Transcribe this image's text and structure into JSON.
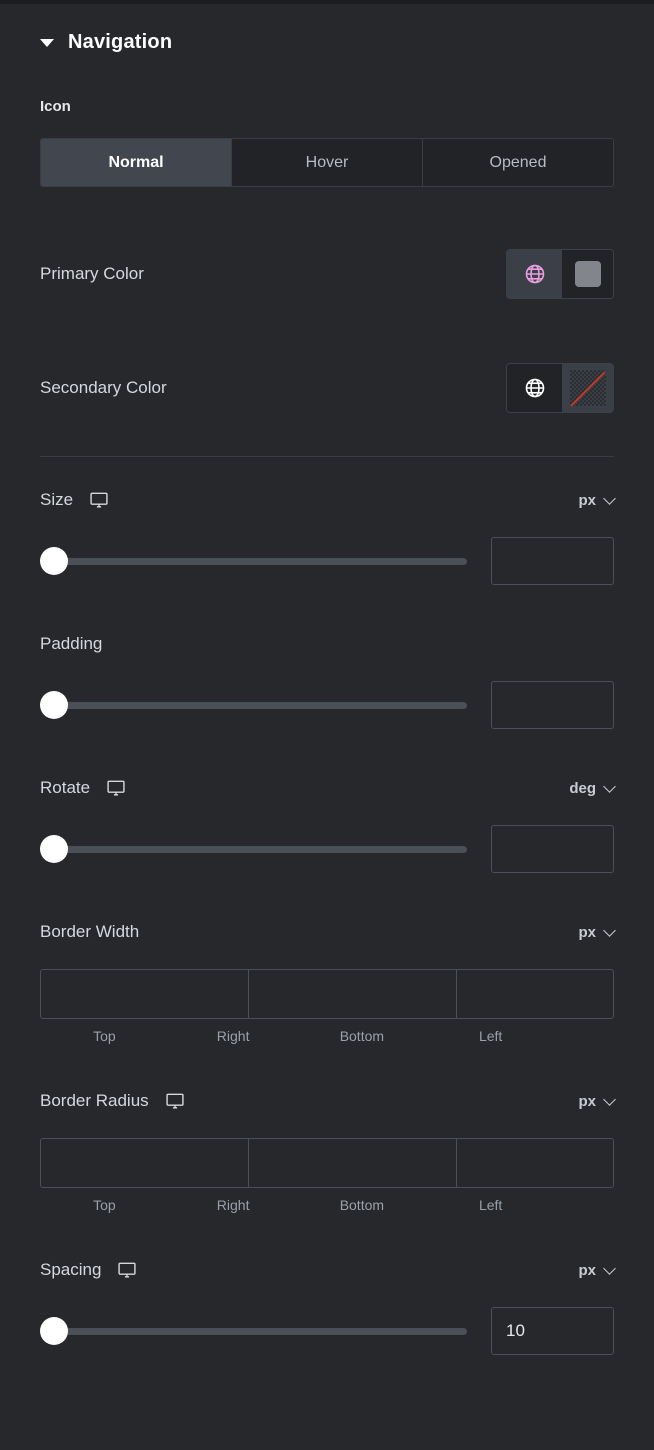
{
  "section": {
    "title": "Navigation",
    "collapse_icon": "caret-down-icon",
    "expanded": true
  },
  "icon_group": {
    "label": "Icon",
    "tabs": [
      {
        "label": "Normal",
        "active": true
      },
      {
        "label": "Hover",
        "active": false
      },
      {
        "label": "Opened",
        "active": false
      }
    ]
  },
  "colors": [
    {
      "label": "Primary Color",
      "globe_icon": "globe-icon",
      "globe_color": "#e79fe0",
      "globe_active": true,
      "swatch_color": "#82868c",
      "swatch_type": "solid"
    },
    {
      "label": "Secondary Color",
      "globe_icon": "globe-icon",
      "globe_color": "#ffffff",
      "globe_active": false,
      "swatch_color": "",
      "swatch_type": "none"
    }
  ],
  "controls": {
    "size": {
      "label": "Size",
      "responsive_icon": "monitor-icon",
      "has_responsive": true,
      "unit": "px",
      "unit_icon": "chevron-down-icon",
      "has_unit": true,
      "value": "",
      "placeholder": "",
      "slider_percent": 0
    },
    "padding": {
      "label": "Padding",
      "has_responsive": false,
      "has_unit": false,
      "unit": "",
      "value": "",
      "placeholder": "",
      "slider_percent": 0
    },
    "rotate": {
      "label": "Rotate",
      "responsive_icon": "monitor-icon",
      "has_responsive": true,
      "unit": "deg",
      "unit_icon": "chevron-down-icon",
      "has_unit": true,
      "value": "",
      "placeholder": "",
      "slider_percent": 0
    },
    "border_width": {
      "label": "Border Width",
      "has_responsive": false,
      "has_unit": true,
      "unit": "px",
      "unit_icon": "chevron-down-icon",
      "link_icon": "link-icon",
      "values": [
        "",
        "",
        "",
        ""
      ],
      "sides": [
        "Top",
        "Right",
        "Bottom",
        "Left"
      ]
    },
    "border_radius": {
      "label": "Border Radius",
      "responsive_icon": "monitor-icon",
      "has_responsive": true,
      "has_unit": true,
      "unit": "px",
      "unit_icon": "chevron-down-icon",
      "link_icon": "link-icon",
      "values": [
        "",
        "",
        "",
        ""
      ],
      "sides": [
        "Top",
        "Right",
        "Bottom",
        "Left"
      ]
    },
    "spacing": {
      "label": "Spacing",
      "responsive_icon": "monitor-icon",
      "has_responsive": true,
      "unit": "px",
      "unit_icon": "chevron-down-icon",
      "has_unit": true,
      "value": "10",
      "placeholder": "",
      "slider_percent": 2
    }
  },
  "theme": {
    "background": "#26282c",
    "panel_dark": "#212327",
    "border": "#3a3d43",
    "accent_active_tab": "#41464f",
    "text_primary": "#ffffff",
    "text_secondary": "#d5d8dc",
    "text_muted": "#9aa0a8",
    "slider_track": "#4a4f58",
    "slider_handle": "#ffffff",
    "no_color_stroke": "#c0392b"
  }
}
